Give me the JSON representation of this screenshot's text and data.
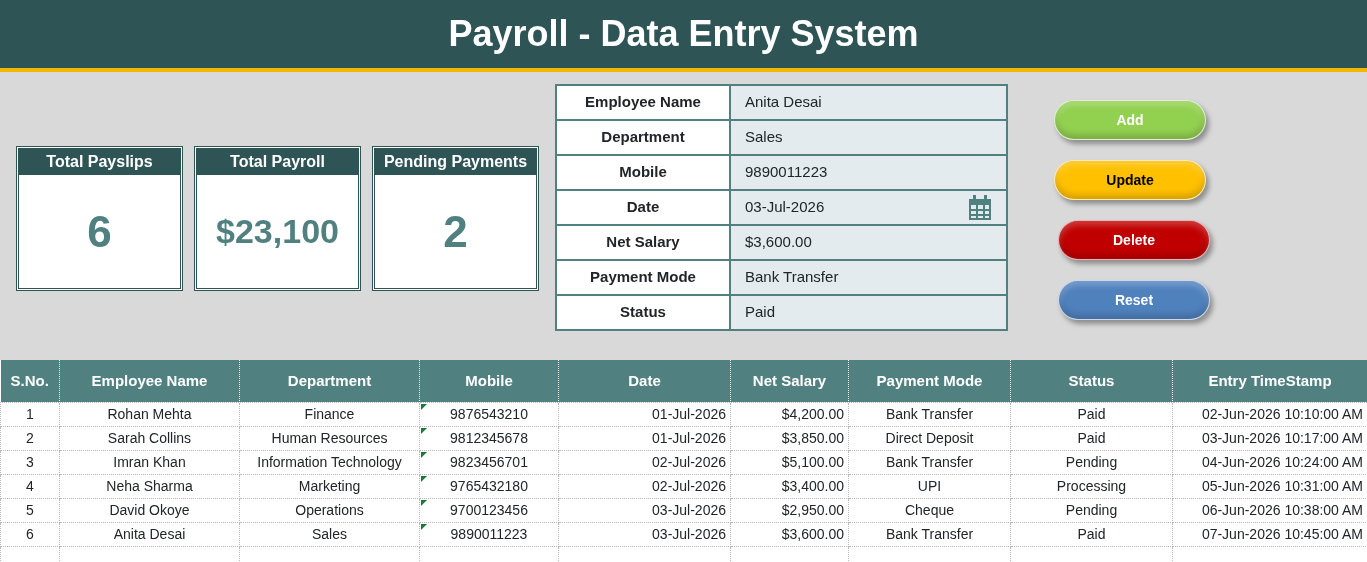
{
  "title": "Payroll - Data Entry System",
  "kpis": [
    {
      "label": "Total Payslips",
      "value": "6"
    },
    {
      "label": "Total Payroll",
      "value": "$23,100"
    },
    {
      "label": "Pending Payments",
      "value": "2"
    }
  ],
  "form": [
    {
      "label": "Employee Name",
      "value": "Anita Desai",
      "kind": "text"
    },
    {
      "label": "Department",
      "value": "Sales",
      "kind": "text"
    },
    {
      "label": "Mobile",
      "value": "9890011223",
      "kind": "text"
    },
    {
      "label": "Date",
      "value": "03-Jul-2026",
      "kind": "date"
    },
    {
      "label": "Net Salary",
      "value": "$3,600.00",
      "kind": "text"
    },
    {
      "label": "Payment Mode",
      "value": "Bank Transfer",
      "kind": "text"
    },
    {
      "label": "Status",
      "value": "Paid",
      "kind": "text"
    }
  ],
  "buttons": [
    {
      "label": "Add",
      "color": "#92d050"
    },
    {
      "label": "Update",
      "color": "#ffc000"
    },
    {
      "label": "Delete",
      "color": "#c00000"
    },
    {
      "label": "Reset",
      "color": "#4f81bd"
    }
  ],
  "table": {
    "columns": [
      "S.No.",
      "Employee Name",
      "Department",
      "Mobile",
      "Date",
      "Net Salary",
      "Payment Mode",
      "Status",
      "Entry TimeStamp"
    ],
    "rows": [
      {
        "cells": [
          "1",
          "Rohan Mehta",
          "Finance",
          "9876543210",
          "01-Jul-2026",
          "$4,200.00",
          "Bank Transfer",
          "Paid",
          "02-Jun-2026 10:10:00 AM"
        ],
        "number_as_text_flag": true
      },
      {
        "cells": [
          "2",
          "Sarah Collins",
          "Human Resources",
          "9812345678",
          "01-Jul-2026",
          "$3,850.00",
          "Direct Deposit",
          "Paid",
          "03-Jun-2026 10:17:00 AM"
        ],
        "number_as_text_flag": true
      },
      {
        "cells": [
          "3",
          "Imran Khan",
          "Information Technology",
          "9823456701",
          "02-Jul-2026",
          "$5,100.00",
          "Bank Transfer",
          "Pending",
          "04-Jun-2026 10:24:00 AM"
        ],
        "number_as_text_flag": true
      },
      {
        "cells": [
          "4",
          "Neha Sharma",
          "Marketing",
          "9765432180",
          "02-Jul-2026",
          "$3,400.00",
          "UPI",
          "Processing",
          "05-Jun-2026 10:31:00 AM"
        ],
        "number_as_text_flag": true
      },
      {
        "cells": [
          "5",
          "David Okoye",
          "Operations",
          "9700123456",
          "03-Jul-2026",
          "$2,950.00",
          "Cheque",
          "Pending",
          "06-Jun-2026 10:38:00 AM"
        ],
        "number_as_text_flag": true
      },
      {
        "cells": [
          "6",
          "Anita Desai",
          "Sales",
          "9890011223",
          "03-Jul-2026",
          "$3,600.00",
          "Bank Transfer",
          "Paid",
          "07-Jun-2026 10:45:00 AM"
        ],
        "number_as_text_flag": true
      }
    ]
  }
}
